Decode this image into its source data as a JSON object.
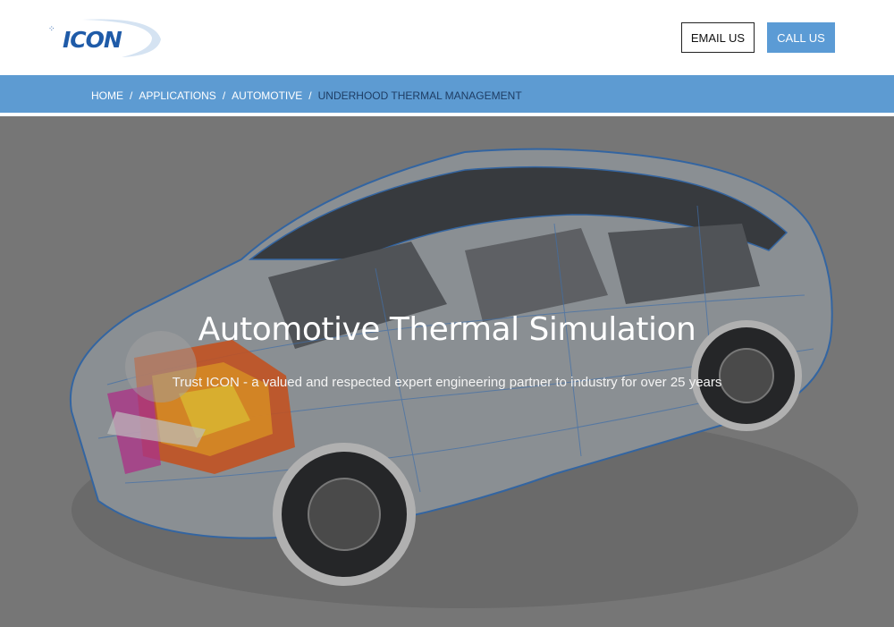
{
  "brand": {
    "logo_text": "ICON",
    "logo_dots": "⁘",
    "accent": "#5b9bd5",
    "dark_blue": "#1f5ba8"
  },
  "header": {
    "email_label": "EMAIL US",
    "call_label": "CALL US"
  },
  "breadcrumb": [
    {
      "label": "HOME"
    },
    {
      "label": "APPLICATIONS"
    },
    {
      "label": "AUTOMOTIVE"
    },
    {
      "label": "UNDERHOOD THERMAL MANAGEMENT"
    }
  ],
  "breadcrumb_separator": "/",
  "hero": {
    "title": "Automotive Thermal Simulation",
    "subtitle": "Trust ICON - a valued and respected expert engineering partner to industry for over 25 years"
  }
}
